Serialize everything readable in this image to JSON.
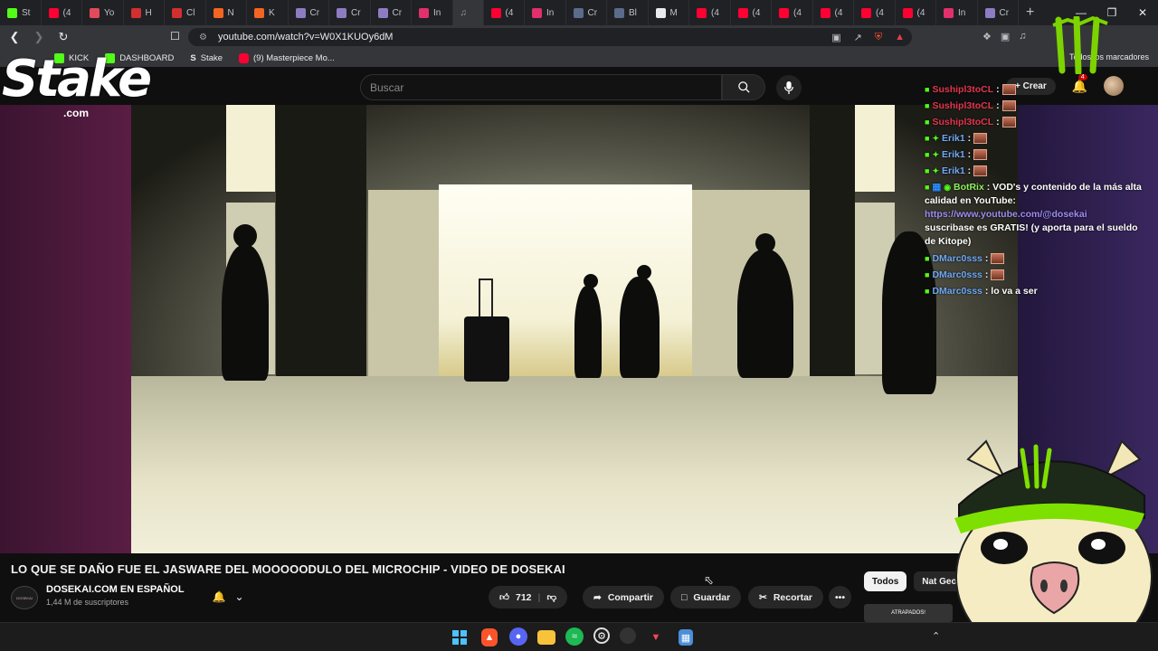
{
  "browser": {
    "tabs": [
      {
        "label": "St",
        "color": "#53fc18"
      },
      {
        "label": "(4",
        "color": "#ff0033"
      },
      {
        "label": "Yo",
        "color": "#e24a5c"
      },
      {
        "label": "H",
        "color": "#d32f2f"
      },
      {
        "label": "Cl",
        "color": "#d32f2f"
      },
      {
        "label": "N",
        "color": "#f26522"
      },
      {
        "label": "K",
        "color": "#f26522"
      },
      {
        "label": "Cr",
        "color": "#8e7cc3"
      },
      {
        "label": "Cr",
        "color": "#8e7cc3"
      },
      {
        "label": "Cr",
        "color": "#8e7cc3"
      },
      {
        "label": "In",
        "color": "#e1306c"
      },
      {
        "label": "",
        "color": "#9aa0a6",
        "active": true
      },
      {
        "label": "(4",
        "color": "#ff0033"
      },
      {
        "label": "In",
        "color": "#e1306c"
      },
      {
        "label": "Cr",
        "color": "#5a6b8c"
      },
      {
        "label": "Bl",
        "color": "#5a6b8c"
      },
      {
        "label": "M",
        "color": "#e8eaed"
      },
      {
        "label": "(4",
        "color": "#ff0033"
      },
      {
        "label": "(4",
        "color": "#ff0033"
      },
      {
        "label": "(4",
        "color": "#ff0033"
      },
      {
        "label": "(4",
        "color": "#ff0033"
      },
      {
        "label": "(4",
        "color": "#ff0033"
      },
      {
        "label": "(4",
        "color": "#ff0033"
      },
      {
        "label": "In",
        "color": "#e1306c"
      },
      {
        "label": "Cr",
        "color": "#8e7cc3"
      }
    ],
    "url": "youtube.com/watch?v=W0X1KUOy6dM",
    "bookmarks": [
      {
        "label": "KICK",
        "icon": "kick-icon"
      },
      {
        "label": "DASHBOARD",
        "icon": "kick-icon"
      },
      {
        "label": "Stake",
        "icon": "stake-icon"
      },
      {
        "label": "(9) Masterpiece Mo...",
        "icon": "youtube-icon"
      }
    ],
    "all_bookmarks": "Todos los marcadores"
  },
  "youtube": {
    "search_placeholder": "Buscar",
    "create_label": "Crear",
    "notifications_count": "4",
    "video_title": "LO QUE SE DAÑO FUE EL JASWARE DEL MOOOOODULO DEL MICROCHIP - VIDEO DE DOSEKAI",
    "channel_name": "DOSEKAI.COM EN ESPAÑOL",
    "subscribers": "1,44 M de suscriptores",
    "like_count": "712",
    "share_label": "Compartir",
    "save_label": "Guardar",
    "clip_label": "Recortar",
    "chips": [
      "Todos",
      "Nat Geo"
    ],
    "thumb_label": "ATRAPADOS!"
  },
  "chat": [
    {
      "user": "Sushipl3toCL",
      "color": "#e3354e",
      "message": ":"
    },
    {
      "user": "Sushipl3toCL",
      "color": "#e3354e",
      "message": ":"
    },
    {
      "user": "Sushipl3toCL",
      "color": "#e3354e",
      "message": ":"
    },
    {
      "user": "Erik1",
      "color": "#6fa8f5",
      "message": ":"
    },
    {
      "user": "Erik1",
      "color": "#6fa8f5",
      "message": ":"
    },
    {
      "user": "Erik1",
      "color": "#6fa8f5",
      "message": ":"
    }
  ],
  "chat_bot": {
    "user": "BotRix",
    "text1": ": VOD's y contenido de la más alta calidad en YouTube:",
    "link": "https://www.youtube.com/@dosekai",
    "text2": "suscribase es GRATIS! (y aporta para el sueldo de Kitope)"
  },
  "chat_after": [
    {
      "user": "DMarc0sss",
      "message": ":"
    },
    {
      "user": "DMarc0sss",
      "message": ":"
    },
    {
      "user": "DMarc0sss",
      "message": ": lo va a ser"
    }
  ],
  "overlay": {
    "stake_text": "Stake",
    "stake_com": ".com"
  },
  "colors": {
    "kick_green": "#53fc18",
    "youtube_red": "#ff0033",
    "background": "#0f0f0f"
  }
}
